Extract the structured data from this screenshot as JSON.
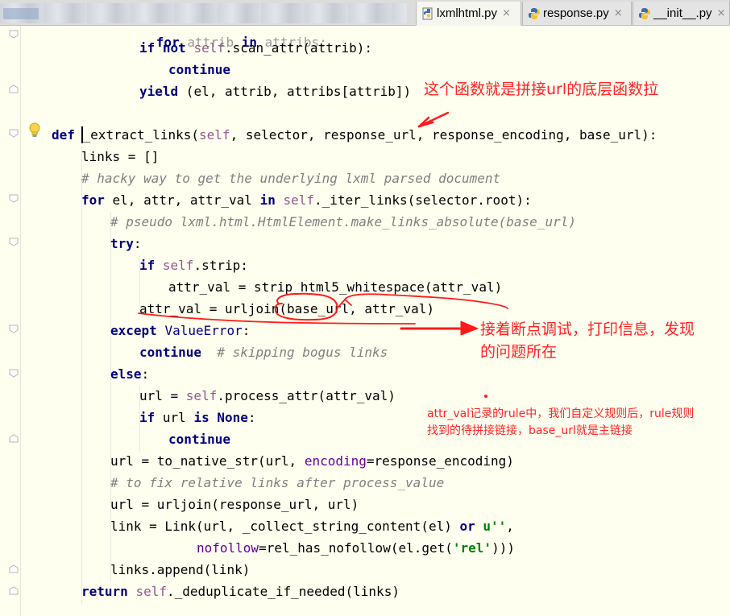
{
  "tabs": [
    {
      "label": "lxmlhtml.py",
      "active": true,
      "close": "×"
    },
    {
      "label": "response.py",
      "active": false,
      "close": "×"
    },
    {
      "label": "__init__.py",
      "active": false,
      "close": "×"
    }
  ],
  "code_lines": [
    "for attrib in attribs:",
    "if not self.scan_attr(attrib):",
    "continue",
    "yield (el, attrib, attribs[attrib])",
    "def _extract_links(self, selector, response_url, response_encoding, base_url):",
    "links = []",
    "# hacky way to get the underlying lxml parsed document",
    "for el, attr, attr_val in self._iter_links(selector.root):",
    "# pseudo lxml.html.HtmlElement.make_links_absolute(base_url)",
    "try:",
    "if self.strip:",
    "attr_val = strip_html5_whitespace(attr_val)",
    "attr_val = urljoin(base_url, attr_val)",
    "except ValueError:",
    "continue  # skipping bogus links",
    "else:",
    "url = self.process_attr(attr_val)",
    "if url is None:",
    "continue",
    "url = to_native_str(url, encoding=response_encoding)",
    "# to fix relative links after process_value",
    "url = urljoin(response_url, url)",
    "link = Link(url, _collect_string_content(el) or u'',",
    "nofollow=rel_has_nofollow(el.get('rel')))",
    "links.append(link)",
    "return self._deduplicate_if_needed(links)"
  ],
  "annotations": {
    "note1": "这个函数就是拼接url的底层函数拉",
    "note2_line1": "接着断点调试，打印信息，发现",
    "note2_line2": "的问题所在",
    "note3_line1": "attr_val记录的rule中，我们自定义规则后，rule规则",
    "note3_line2": "找到的待拼接链接，base_url就是主链接",
    "color": "#ff2222"
  },
  "colors": {
    "background": "#fffff0",
    "keyword": "#000080",
    "self": "#94558d",
    "comment": "#808080",
    "param": "#660099",
    "string": "#008000"
  },
  "icons": {
    "tab_file_icon": "python-file-icon",
    "gutter_hint": "lightbulb-icon",
    "fold_marker": "fold-marker-icon"
  }
}
